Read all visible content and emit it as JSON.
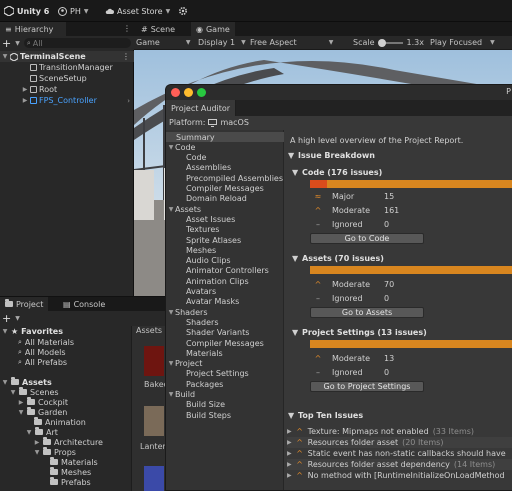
{
  "topbar": {
    "app_label": "Unity 6",
    "account": "PH",
    "store": "Asset Store"
  },
  "hierarchy": {
    "tab": "Hierarchy",
    "search_placeholder": "All",
    "items": [
      {
        "label": "TerminalScene"
      },
      {
        "label": "TransitionManager"
      },
      {
        "label": "SceneSetup"
      },
      {
        "label": "Root"
      },
      {
        "label": "FPS_Controller"
      }
    ]
  },
  "scene": {
    "tab_scene": "Scene",
    "tab_game": "Game",
    "display_mode": "Game",
    "display": "Display 1",
    "aspect": "Free Aspect",
    "scale_label": "Scale",
    "scale_value": "1.3x",
    "play_mode": "Play Focused"
  },
  "project": {
    "tab_project": "Project",
    "tab_console": "Console",
    "assets_header": "Assets",
    "favorites": "Favorites",
    "fav_items": [
      "All Materials",
      "All Models",
      "All Prefabs"
    ],
    "tree": [
      "Assets",
      "Scenes",
      "Cockpit",
      "Garden",
      "Animation",
      "Art",
      "Architecture",
      "Props",
      "Materials",
      "Meshes",
      "Prefabs"
    ],
    "thumb_labels": [
      "Baked",
      "Lantern"
    ]
  },
  "auditor": {
    "title": "Project Auditor",
    "platform_label": "Platform:",
    "platform_value": "macOS",
    "title_suffix": "P",
    "nav": {
      "summary": "Summary",
      "groups": [
        {
          "label": "Code",
          "items": [
            "Code",
            "Assemblies",
            "Precompiled Assemblies",
            "Compiler Messages",
            "Domain Reload"
          ]
        },
        {
          "label": "Assets",
          "items": [
            "Asset Issues",
            "Textures",
            "Sprite Atlases",
            "Meshes",
            "Audio Clips",
            "Animator Controllers",
            "Animation Clips",
            "Avatars",
            "Avatar Masks"
          ]
        },
        {
          "label": "Shaders",
          "items": [
            "Shaders",
            "Shader Variants",
            "Compiler Messages",
            "Materials"
          ]
        },
        {
          "label": "Project",
          "items": [
            "Project Settings",
            "Packages"
          ]
        },
        {
          "label": "Build",
          "items": [
            "Build Size",
            "Build Steps"
          ]
        }
      ]
    },
    "overview": "A high level overview of the Project Report.",
    "breakdown_title": "Issue Breakdown",
    "code": {
      "title": "Code (176 issues)",
      "major_label": "Major",
      "major_value": "15",
      "major_fraction": 0.085,
      "moderate_label": "Moderate",
      "moderate_value": "161",
      "ignored_label": "Ignored",
      "ignored_value": "0",
      "button": "Go to Code"
    },
    "assets": {
      "title": "Assets (70 issues)",
      "moderate_label": "Moderate",
      "moderate_value": "70",
      "ignored_label": "Ignored",
      "ignored_value": "0",
      "button": "Go to Assets"
    },
    "settings": {
      "title": "Project Settings (13 issues)",
      "moderate_label": "Moderate",
      "moderate_value": "13",
      "ignored_label": "Ignored",
      "ignored_value": "0",
      "button": "Go to Project Settings"
    },
    "topten_title": "Top Ten Issues",
    "topten": [
      {
        "text": "Texture: Mipmaps not enabled",
        "count": "(33 Items)"
      },
      {
        "text": "Resources folder asset",
        "count": "(20 Items)"
      },
      {
        "text": "Static event has non-static callbacks should have",
        "count": ""
      },
      {
        "text": "Resources folder asset dependency",
        "count": "(14 Items)"
      },
      {
        "text": "No method with [RuntimeInitializeOnLoadMethod",
        "count": ""
      }
    ],
    "colors": {
      "major": "#d94c1c",
      "moderate": "#d8861f"
    }
  }
}
